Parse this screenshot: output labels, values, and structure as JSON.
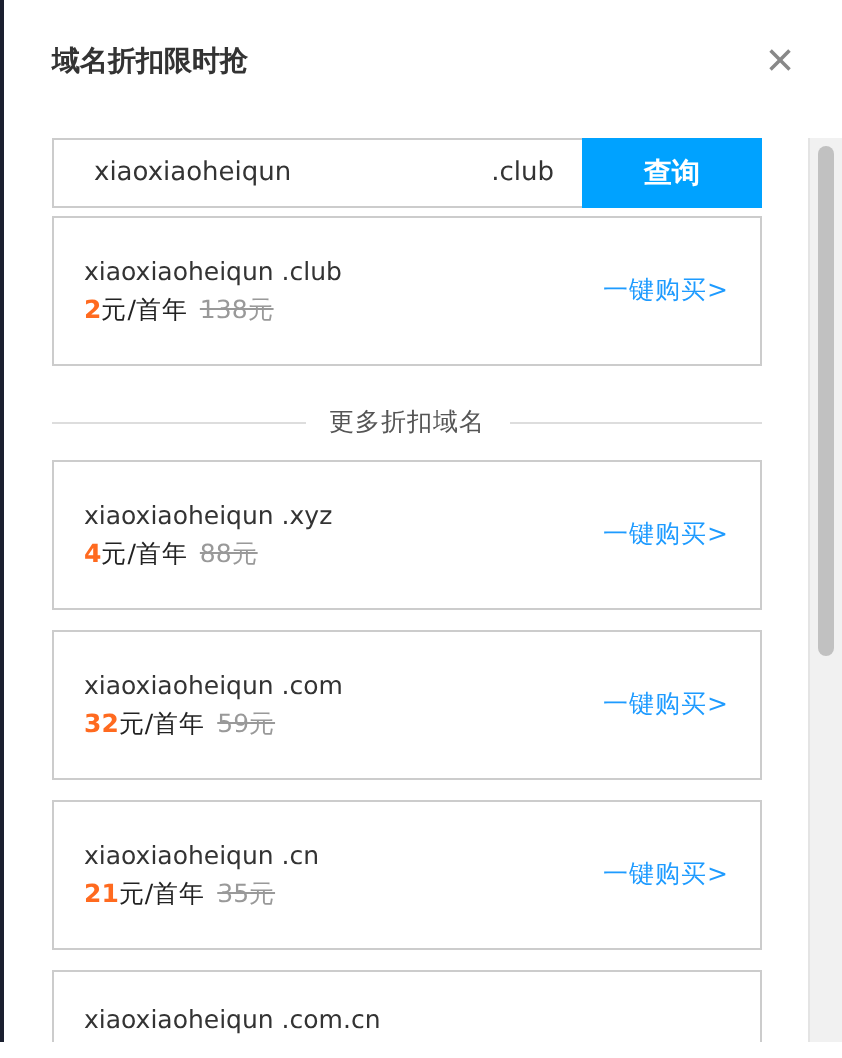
{
  "dialog": {
    "title": "域名折扣限时抢",
    "close": "×"
  },
  "search": {
    "value": "xiaoxiaoheiqun",
    "suffix": ".club",
    "button": "查询"
  },
  "result": {
    "name": "xiaoxiaoheiqun .club",
    "price": "2",
    "unit": "元/首年",
    "original": "138元",
    "buy": "一键购买>"
  },
  "divider": "更多折扣域名",
  "domains": [
    {
      "name": "xiaoxiaoheiqun .xyz",
      "price": "4",
      "unit": "元/首年",
      "original": "88元",
      "buy": "一键购买>"
    },
    {
      "name": "xiaoxiaoheiqun .com",
      "price": "32",
      "unit": "元/首年",
      "original": "59元",
      "buy": "一键购买>"
    },
    {
      "name": "xiaoxiaoheiqun .cn",
      "price": "21",
      "unit": "元/首年",
      "original": "35元",
      "buy": "一键购买>"
    },
    {
      "name": "xiaoxiaoheiqun .com.cn"
    }
  ]
}
